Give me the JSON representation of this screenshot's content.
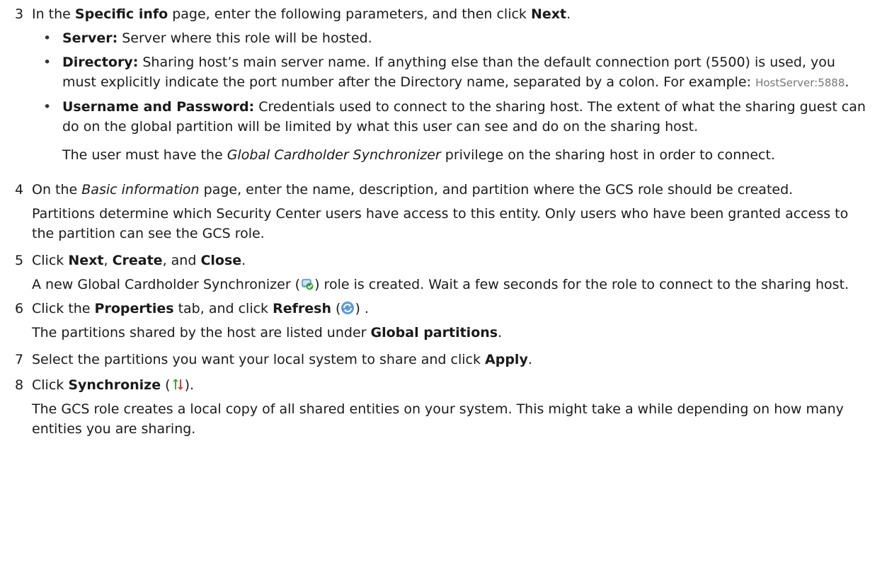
{
  "steps": [
    {
      "num": "3",
      "t1": "In the ",
      "b1": "Specific info",
      "t2": " page, enter the following parameters, and then click ",
      "b2": "Next",
      "t3": ".",
      "bullets": [
        {
          "label": "Server:",
          "text": " Server where this role will be hosted."
        },
        {
          "label": "Directory:",
          "text": " Sharing host’s main server name. If anything else than the default connection port (5500) is used, you must explicitly indicate the port number after the Directory name, separated by a colon. For example: ",
          "code": "HostServer:5888",
          "end": "."
        },
        {
          "label": "Username and Password:",
          "text": " Credentials used to connect to the sharing host. The extent of what the sharing guest can do on the global partition will be limited by what this user can see and do on the sharing host."
        }
      ],
      "note": {
        "t1": "The user must have the ",
        "i1": "Global Cardholder Synchronizer",
        "t2": " privilege on the sharing host in order to connect."
      }
    },
    {
      "num": "4",
      "t1": "On the ",
      "i1": "Basic information",
      "t2": " page, enter the name, description, and partition where the GCS role should be created.",
      "para": "Partitions determine which Security Center users have access to this entity. Only users who have been granted access to the partition can see the GCS role."
    },
    {
      "num": "5",
      "t1": "Click ",
      "b1": "Next",
      "t2": ", ",
      "b2": "Create",
      "t3": ", and ",
      "b3": "Close",
      "t4": ".",
      "para_a": "A new Global Cardholder Synchronizer (",
      "para_b": ") role is created. Wait a few seconds for the role to connect to the sharing host."
    },
    {
      "num": "6",
      "t1": "Click the ",
      "b1": "Properties",
      "t2": " tab, and click ",
      "b2": "Refresh",
      "t3": " (",
      "t4": ") .",
      "para_a": "The partitions shared by the host are listed under ",
      "para_b": "Global partitions",
      "para_c": "."
    },
    {
      "num": "7",
      "t1": "Select the partitions you want your local system to share and click ",
      "b1": "Apply",
      "t2": "."
    },
    {
      "num": "8",
      "t1": "Click ",
      "b1": "Synchronize",
      "t2": " (",
      "t3": ").",
      "para": "The GCS role creates a local copy of all shared entities on your system. This might take a while depending on how many entities you are sharing."
    }
  ],
  "icons": {
    "gcs_role": "gcs-role-icon",
    "refresh": "refresh-icon",
    "synchronize": "synchronize-icon"
  }
}
